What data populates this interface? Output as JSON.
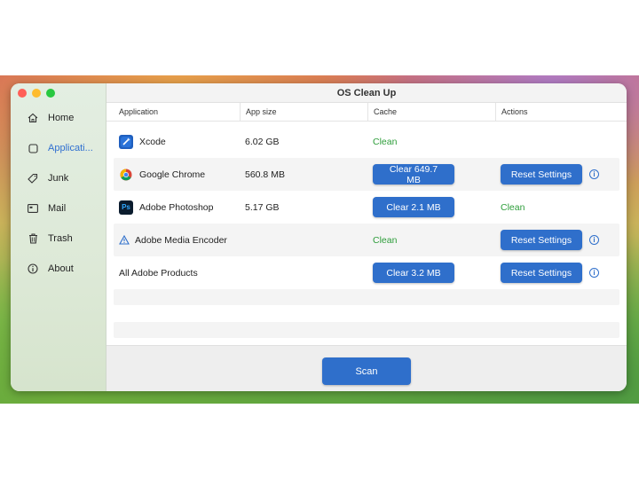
{
  "window": {
    "title": "OS Clean Up"
  },
  "sidebar": {
    "items": [
      {
        "label": "Home",
        "icon": "house-icon"
      },
      {
        "label": "Applicati...",
        "icon": "square-icon"
      },
      {
        "label": "Junk",
        "icon": "tag-icon"
      },
      {
        "label": "Mail",
        "icon": "mail-icon"
      },
      {
        "label": "Trash",
        "icon": "trash-icon"
      },
      {
        "label": "About",
        "icon": "info-circle-icon"
      }
    ],
    "active_index": 1
  },
  "table": {
    "columns": [
      "Application",
      "App size",
      "Cache",
      "Actions"
    ],
    "rows": [
      {
        "app": "Xcode",
        "size": "6.02 GB",
        "cache_text": "Clean",
        "action_text": ""
      },
      {
        "app": "Google Chrome",
        "size": "560.8 MB",
        "cache_button": "Clear 649.7 MB",
        "action_button": "Reset Settings"
      },
      {
        "app": "Adobe Photoshop",
        "size": "5.17 GB",
        "cache_button": "Clear 2.1 MB",
        "action_text": "Clean"
      },
      {
        "app": "Adobe Media Encoder",
        "size": "",
        "cache_text": "Clean",
        "action_button": "Reset Settings"
      },
      {
        "app": "All Adobe Products",
        "size": "",
        "cache_button": "Clear 3.2 MB",
        "action_button": "Reset Settings"
      }
    ]
  },
  "icons": {
    "ps_label": "Ps"
  },
  "footer": {
    "scan_label": "Scan"
  },
  "colors": {
    "accent": "#2f6fcb",
    "clean_green": "#2d9d3a"
  }
}
